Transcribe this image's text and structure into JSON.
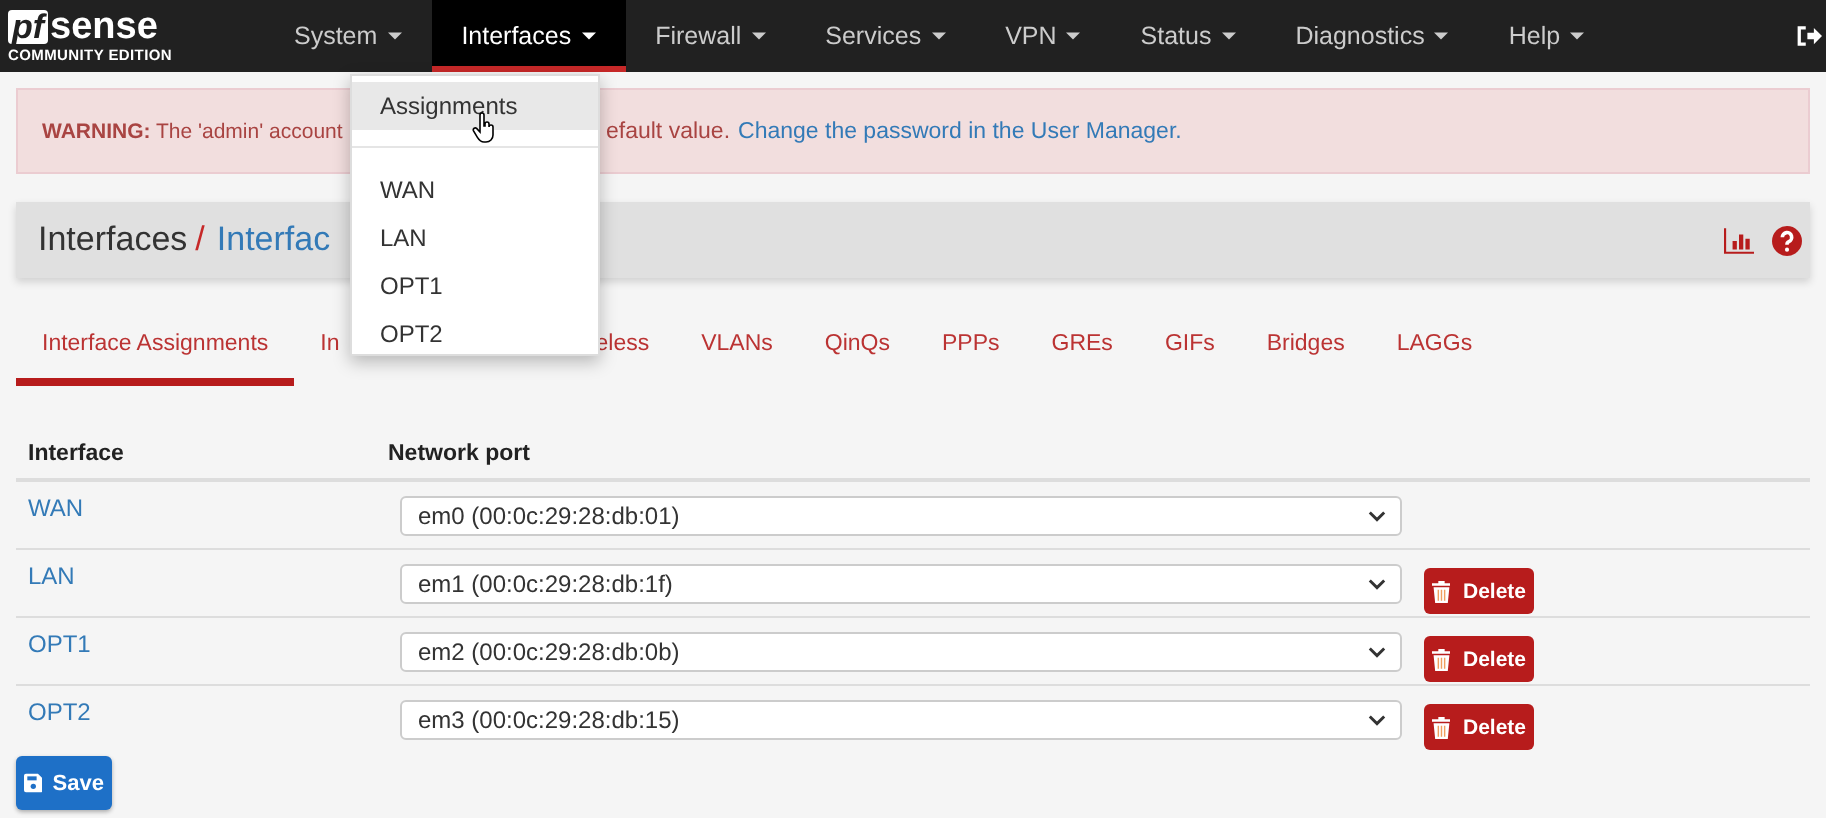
{
  "logo": {
    "mark": "pf",
    "word": "sense",
    "edition": "COMMUNITY EDITION"
  },
  "nav": [
    {
      "label": "System",
      "selected": false
    },
    {
      "label": "Interfaces",
      "selected": true
    },
    {
      "label": "Firewall",
      "selected": false
    },
    {
      "label": "Services",
      "selected": false
    },
    {
      "label": "VPN",
      "selected": false
    },
    {
      "label": "Status",
      "selected": false
    },
    {
      "label": "Diagnostics",
      "selected": false
    },
    {
      "label": "Help",
      "selected": false
    }
  ],
  "nav_menu": [
    {
      "kind": "item",
      "label": "Assignments",
      "hovered": true
    },
    {
      "kind": "divider"
    },
    {
      "kind": "item",
      "label": "WAN",
      "hovered": false
    },
    {
      "kind": "item",
      "label": "LAN",
      "hovered": false
    },
    {
      "kind": "item",
      "label": "OPT1",
      "hovered": false
    },
    {
      "kind": "item",
      "label": "OPT2",
      "hovered": false
    }
  ],
  "warning": {
    "text_before": "**WARNING:** The 'admin' account",
    "text_after": "efault value.",
    "link": "Change the password in the User Manager."
  },
  "breadcrumb": {
    "parent": "Interfaces",
    "separator": "/",
    "current": "Interfac"
  },
  "tabs": [
    {
      "label": "Interface Assignments",
      "selected": true
    },
    {
      "label": "In",
      "selected": false
    },
    {
      "label": "eless",
      "selected": false
    },
    {
      "label": "VLANs",
      "selected": false
    },
    {
      "label": "QinQs",
      "selected": false
    },
    {
      "label": "PPPs",
      "selected": false
    },
    {
      "label": "GREs",
      "selected": false
    },
    {
      "label": "GIFs",
      "selected": false
    },
    {
      "label": "Bridges",
      "selected": false
    },
    {
      "label": "LAGGs",
      "selected": false
    }
  ],
  "table": {
    "columns": [
      "Interface",
      "Network port"
    ],
    "rows": [
      {
        "interface": "WAN",
        "port": "em0 (00:0c:29:28:db:01)"
      },
      {
        "interface": "LAN",
        "port": "em1 (00:0c:29:28:db:1f)",
        "action": "Delete"
      },
      {
        "interface": "OPT1",
        "port": "em2 (00:0c:29:28:db:0b)",
        "action": "Delete"
      },
      {
        "interface": "OPT2",
        "port": "em3 (00:0c:29:28:db:15)",
        "action": "Delete"
      }
    ]
  },
  "save_button": "Save"
}
